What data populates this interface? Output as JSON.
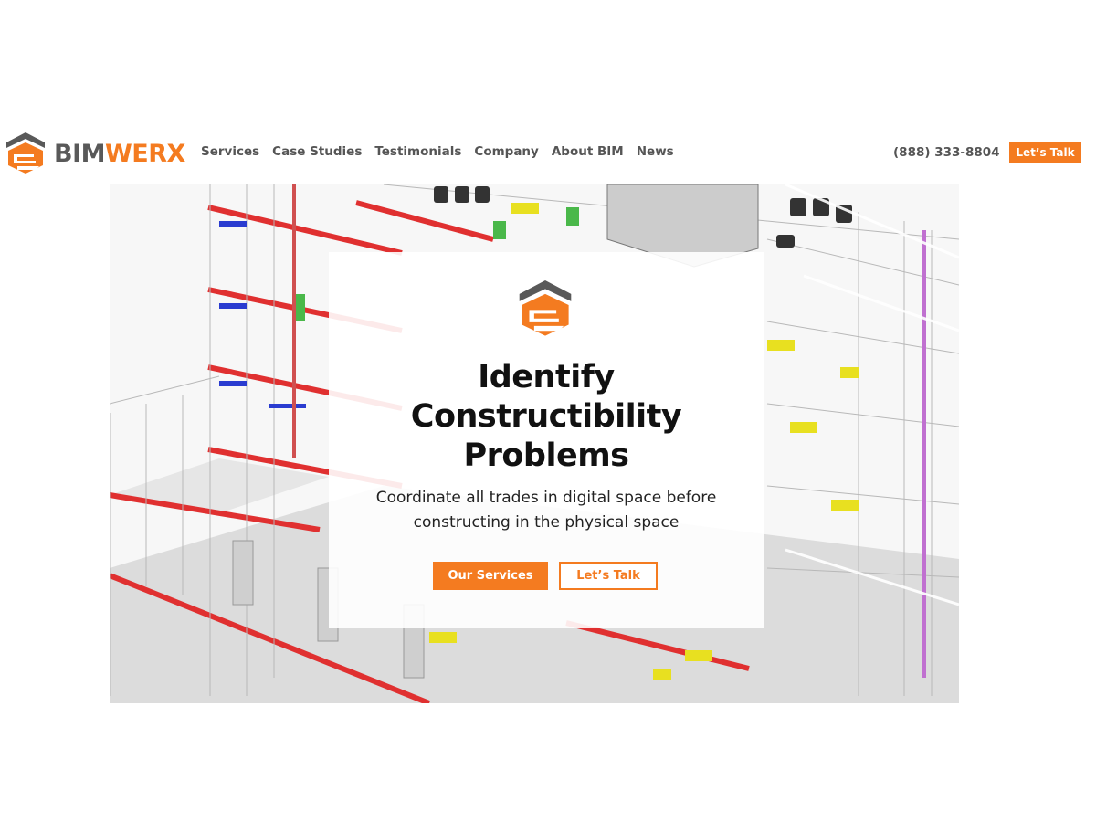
{
  "brand": {
    "name_part1": "BIM",
    "name_part2": "WERX",
    "accent_color": "#f47b20",
    "gray_color": "#595959"
  },
  "nav": {
    "items": [
      "Services",
      "Case Studies",
      "Testimonials",
      "Company",
      "About BIM",
      "News"
    ]
  },
  "header": {
    "phone": "(888) 333-8804",
    "cta_label": "Let’s Talk"
  },
  "hero": {
    "title_line1": "Identify",
    "title_line2": "Constructibility",
    "title_line3": "Problems",
    "subtitle_line1": "Coordinate all trades in digital space before",
    "subtitle_line2": "constructing in the physical space",
    "primary_button": "Our Services",
    "secondary_button": "Let’s Talk",
    "background_image": "bim-building-wireframe"
  }
}
